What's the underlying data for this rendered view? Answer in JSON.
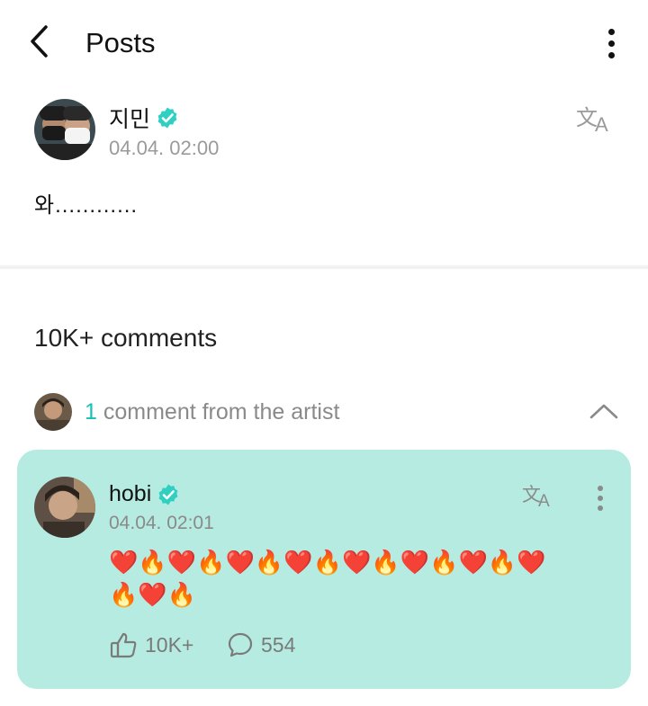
{
  "header": {
    "title": "Posts"
  },
  "post": {
    "author": "지민",
    "timestamp": "04.04. 02:00",
    "body": "와............"
  },
  "comments": {
    "count_label": "10K+ comments",
    "artist_summary": {
      "count": "1",
      "label": "comment from the artist"
    }
  },
  "artist_comment": {
    "author": "hobi",
    "timestamp": "04.04. 02:01",
    "body": "❤️🔥❤️🔥❤️🔥❤️🔥❤️🔥❤️🔥❤️🔥❤️🔥❤️🔥",
    "likes": "10K+",
    "replies": "554"
  },
  "icons": {
    "back": "chevron-left-icon",
    "more": "more-vertical-icon",
    "verified": "verified-badge-icon",
    "translate": "translate-icon",
    "collapse": "chevron-up-icon",
    "like": "like-icon",
    "reply": "comment-bubble-icon"
  },
  "colors": {
    "accent": "#19c0b3",
    "card_background": "#b5ebe0",
    "verified": "#2fcfc2"
  }
}
